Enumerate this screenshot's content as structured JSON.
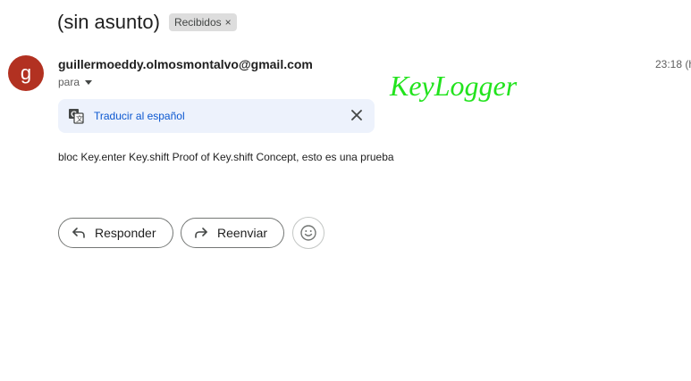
{
  "subject": {
    "title": "(sin asunto)",
    "label": "Recibidos",
    "label_remove": "×"
  },
  "message": {
    "avatar_letter": "g",
    "sender": "guillermoeddy.olmosmontalvo@gmail.com",
    "to_label": "para",
    "time": "23:18 (h",
    "body": "bloc Key.enter  Key.shift Proof of  Key.shift Concept, esto es una prueba"
  },
  "overlay": {
    "text": "KeyLogger",
    "color": "#22e31d"
  },
  "translate": {
    "label": "Traducir al español"
  },
  "actions": {
    "reply": "Responder",
    "forward": "Reenviar"
  },
  "colors": {
    "avatar": "#b23121",
    "link": "#0b57d0",
    "translate_bg": "#edf2fc"
  },
  "icons": [
    "translate-icon",
    "close-icon",
    "reply-icon",
    "forward-icon",
    "emoji-icon",
    "chevron-down-icon"
  ]
}
